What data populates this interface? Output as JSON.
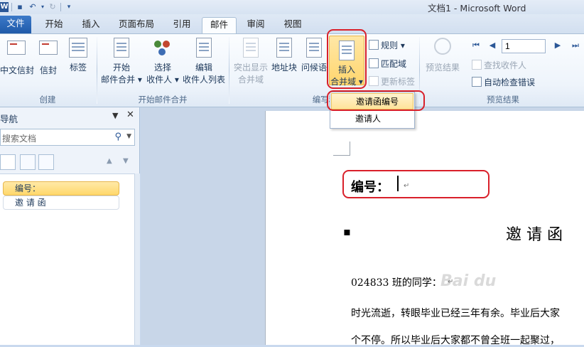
{
  "window": {
    "title": "文档1 - Microsoft Word"
  },
  "qat": {
    "app_icon": "W"
  },
  "tabs": [
    {
      "label": "文件"
    },
    {
      "label": "开始"
    },
    {
      "label": "插入"
    },
    {
      "label": "页面布局"
    },
    {
      "label": "引用"
    },
    {
      "label": "邮件"
    },
    {
      "label": "审阅"
    },
    {
      "label": "视图"
    }
  ],
  "ribbon": {
    "create": {
      "label": "创建",
      "chinese_envelope": "中文信封",
      "envelopes": "信封",
      "labels": "标签"
    },
    "start_merge": {
      "label": "开始邮件合并",
      "start_line1": "开始",
      "start_line2": "邮件合并 ▾",
      "select_line1": "选择",
      "select_line2": "收件人 ▾",
      "edit_line1": "编辑",
      "edit_line2": "收件人列表"
    },
    "write_insert": {
      "label": "编写和",
      "highlight_line1": "突出显示",
      "highlight_line2": "合并域",
      "address_block": "地址块",
      "greeting_line": "问候语",
      "insert_line1": "插入",
      "insert_line2": "合并域 ▾",
      "rules": "规则 ▾",
      "match_fields": "匹配域",
      "update_labels": "更新标签"
    },
    "preview": {
      "label": "预览结果",
      "preview_results": "预览结果",
      "record_value": "1",
      "find_recipient": "查找收件人",
      "auto_check": "自动检查错误"
    }
  },
  "dropdown": {
    "items": [
      "邀请函编号",
      "邀请人"
    ],
    "highlighted": "邀请函编号"
  },
  "nav_pane": {
    "title": "导航",
    "search_placeholder": "搜索文档",
    "headings": [
      "编号：",
      "邀 请 函"
    ]
  },
  "document": {
    "number_label": "编号：",
    "heading": "邀 请 函",
    "salutation": "024833 班的同学：",
    "line1": "时光流逝，转眼毕业已经三年有余。毕业后大家",
    "line2": "个不停。所以毕业后大家都不曾全班一起聚过，"
  },
  "watermark": "Bai du"
}
